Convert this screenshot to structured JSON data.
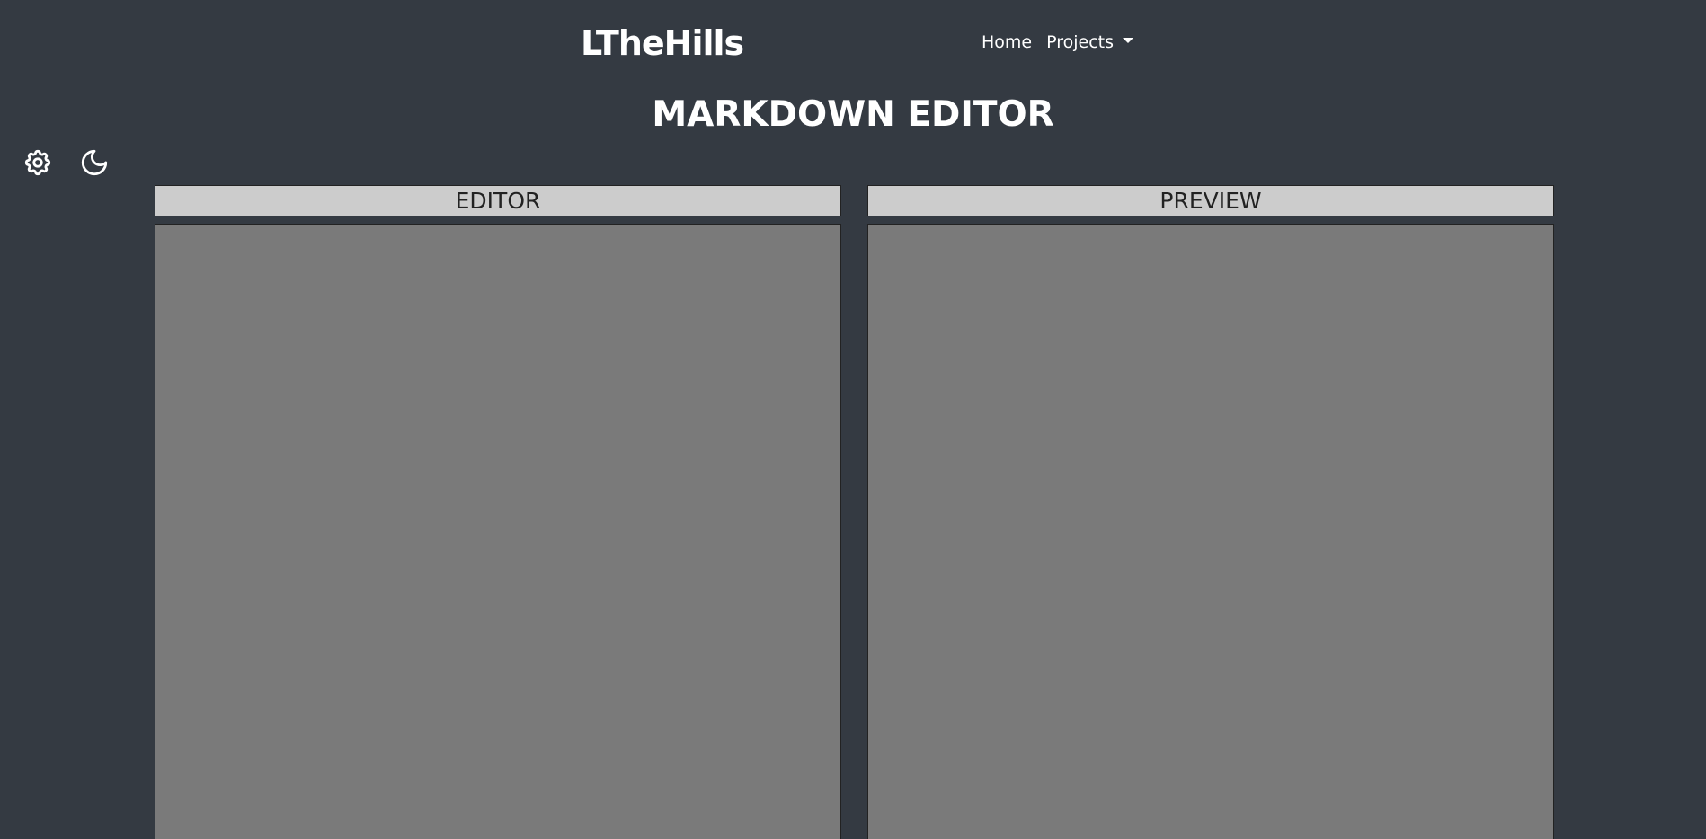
{
  "navbar": {
    "brand": "LTheHills",
    "links": [
      {
        "label": "Home"
      },
      {
        "label": "Projects"
      }
    ]
  },
  "page": {
    "title": "MARKDOWN EDITOR"
  },
  "toolbar": {
    "settings_icon": "gear-icon",
    "theme_icon": "moon-icon"
  },
  "editor": {
    "header": "EDITOR",
    "value": ""
  },
  "preview": {
    "header": "PREVIEW",
    "content": ""
  },
  "colors": {
    "background": "#343a42",
    "panel_header": "#cccccc",
    "panel_body": "#7a7a7a",
    "text": "#ffffff"
  }
}
